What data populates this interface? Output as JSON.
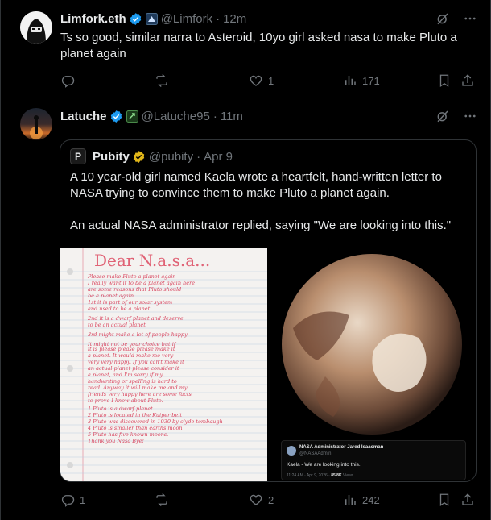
{
  "colors": {
    "background": "#000000",
    "text": "#e7e9ea",
    "muted": "#71767b",
    "verified": "#1d9bf0",
    "gold": "#e2b719",
    "border": "#2f3336"
  },
  "tweet1": {
    "name": "Limfork.eth",
    "handle": "@Limfork",
    "sep": "·",
    "time": "12m",
    "text": "Ts so good, similar narra to Asteroid, 10yo girl asked nasa to make Pluto a planet again",
    "replies": "",
    "reposts": "",
    "likes": "1",
    "views": "171",
    "icons": [
      "grok-icon",
      "more-icon",
      "reply-icon",
      "repost-icon",
      "like-icon",
      "views-icon",
      "bookmark-icon",
      "share-icon"
    ]
  },
  "tweet2": {
    "name": "Latuche",
    "handle": "@Latuche95",
    "sep": "·",
    "time": "11m",
    "replies": "1",
    "reposts": "",
    "likes": "2",
    "views": "242"
  },
  "quote": {
    "avatar_letter": "P",
    "name": "Pubity",
    "handle": "@pubity",
    "sep": "·",
    "date": "Apr 9",
    "text1": "A 10 year-old girl named Kaela wrote a heartfelt, hand-written letter to NASA trying to convince them to make Pluto a planet again.",
    "text2": "An actual NASA administrator replied, saying \"We are looking into this.\"",
    "letter": {
      "title": "Dear N.a.s.a...",
      "lines": [
        "Please make Pluto a planet again",
        "I really want it to be a planet again here",
        "are some reasons that Pluto should",
        "be a planet again",
        "1st it is part of our solar system",
        "and used to be a planet",
        "2nd it is a dwarf planet and deserve",
        "to be an actual planet",
        "3rd might make a lot of people happy",
        "It might not be your choice but if",
        "it is please please please make it",
        "a planet. It would make me very",
        "very very happy. If you can't make it",
        "an actual planet please consider it",
        "a planet, and I'm sorry if my",
        "handwriting or spelling is hard to",
        "read. Anyway it will make me and my",
        "friends very happy here are some facts",
        "to prove I know about Pluto.",
        "1 Pluto is a dwarf planet",
        "2 Pluto is located in the Kuiper belt",
        "3 Pluto was discovered in 1930 by clyde tombaugh",
        "4 Pluto is smaller than earths moon",
        "5 Pluto has five known moons.",
        "Thank you Nasa Bye!"
      ]
    },
    "inset": {
      "name": "NASA Administrator Jared Isaacman",
      "handle": "@NASAAdmin",
      "text": "Kaela - We are looking into this.",
      "time": "11:24 AM · Apr 9, 2026",
      "views": "85.8K",
      "views_label": "Views"
    }
  }
}
